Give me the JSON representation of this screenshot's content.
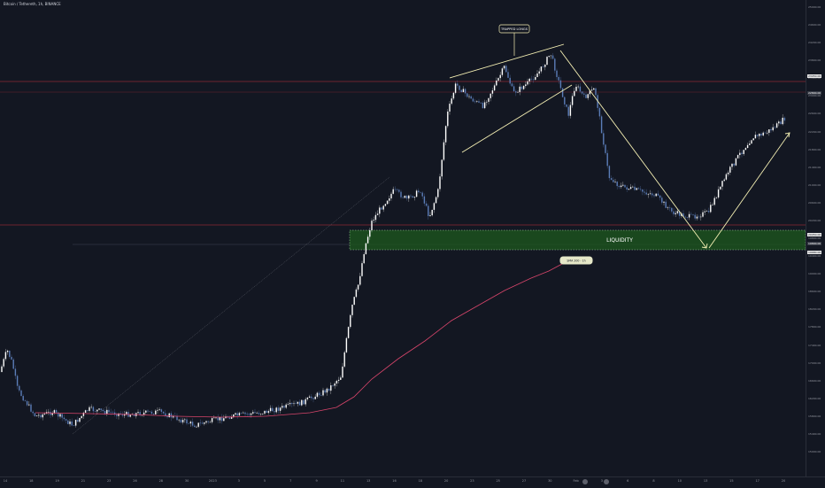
{
  "header": {
    "symbol_text": "Bitcoin / Tethereth, 1h, BINANCE"
  },
  "annotations": {
    "trapped_label": "TRAPPED LONGS",
    "liquidity_label": "LIQUIDITY",
    "ma_label": "SMA 200 - 1h"
  },
  "price_axis": {
    "labels": [
      "25000.00",
      "24600.00",
      "24200.00",
      "23800.00",
      "23400.00",
      "23000.00",
      "22600.00",
      "22200.00",
      "21800.00",
      "21400.00",
      "21000.00",
      "20600.00",
      "20200.00",
      "19800.00",
      "19400.00",
      "19000.00",
      "18600.00",
      "18200.00",
      "17800.00",
      "17400.00",
      "17000.00",
      "16600.00",
      "16200.00",
      "15800.00",
      "15400.00",
      "15000.00"
    ],
    "tags": [
      {
        "text": "23050.00",
        "style": "white",
        "level": 0.84
      },
      {
        "text": "22800.00",
        "style": "grayd",
        "level": 0.805
      },
      {
        "text": "20050.00",
        "style": "white",
        "level": 0.508
      },
      {
        "text": "19800.00",
        "style": "grayd",
        "level": 0.488
      },
      {
        "text": "19680.00",
        "style": "white",
        "level": 0.47
      }
    ]
  },
  "time_axis": {
    "labels": [
      "14",
      "18",
      "19",
      "21",
      "23",
      "26",
      "28",
      "30",
      "2023",
      "3",
      "5",
      "7",
      "9",
      "11",
      "13",
      "16",
      "18",
      "20",
      "23",
      "25",
      "27",
      "30",
      "Feb",
      "3",
      "6",
      "8",
      "10",
      "13",
      "15",
      "17",
      "20"
    ]
  },
  "colors": {
    "background": "#131722",
    "up": "#ffffff",
    "down": "#5b7db8",
    "ma": "#d8456b",
    "liquidity_zone": "#1e5a1e",
    "resistance_line": "#f23645"
  }
}
